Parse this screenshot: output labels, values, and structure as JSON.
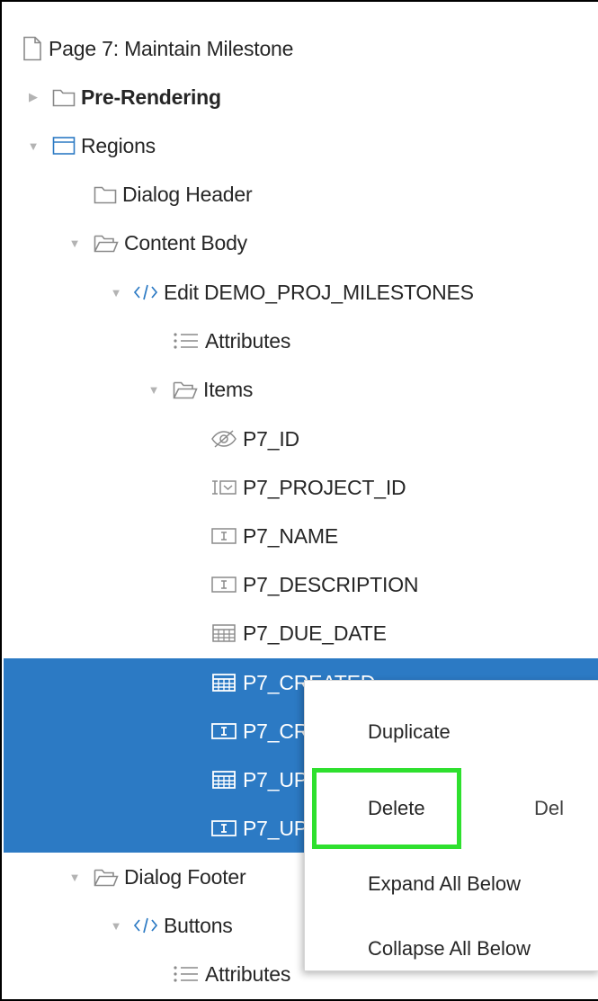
{
  "tree": {
    "rows": [
      {
        "label": "Page 7: Maintain Milestone",
        "icon": "page-icon",
        "toggle": "none"
      },
      {
        "label": "Pre-Rendering",
        "icon": "folder-icon",
        "toggle": "collapsed",
        "bold": true
      },
      {
        "label": "Regions",
        "icon": "region-icon",
        "toggle": "expanded"
      },
      {
        "label": "Dialog Header",
        "icon": "folder-icon",
        "toggle": "none"
      },
      {
        "label": "Content Body",
        "icon": "folder-open-icon",
        "toggle": "expanded"
      },
      {
        "label": "Edit DEMO_PROJ_MILESTONES",
        "icon": "code-icon",
        "toggle": "expanded"
      },
      {
        "label": "Attributes",
        "icon": "list-icon",
        "toggle": "none"
      },
      {
        "label": "Items",
        "icon": "folder-open-icon",
        "toggle": "expanded"
      },
      {
        "label": "P7_ID",
        "icon": "hidden-item-icon",
        "toggle": "none"
      },
      {
        "label": "P7_PROJECT_ID",
        "icon": "select-list-icon",
        "toggle": "none"
      },
      {
        "label": "P7_NAME",
        "icon": "text-field-icon",
        "toggle": "none"
      },
      {
        "label": "P7_DESCRIPTION",
        "icon": "text-field-icon",
        "toggle": "none"
      },
      {
        "label": "P7_DUE_DATE",
        "icon": "date-picker-icon",
        "toggle": "none"
      },
      {
        "label": "P7_CREATED",
        "icon": "date-picker-icon",
        "toggle": "none",
        "selected": true
      },
      {
        "label": "P7_CREATED_BY",
        "icon": "text-field-icon",
        "toggle": "none",
        "selected": true
      },
      {
        "label": "P7_UPDATED",
        "icon": "date-picker-icon",
        "toggle": "none",
        "selected": true
      },
      {
        "label": "P7_UPDATED_BY",
        "icon": "text-field-icon",
        "toggle": "none",
        "selected": true
      },
      {
        "label": "Dialog Footer",
        "icon": "folder-open-icon",
        "toggle": "expanded"
      },
      {
        "label": "Buttons",
        "icon": "code-icon",
        "toggle": "expanded"
      },
      {
        "label": "Attributes",
        "icon": "list-icon",
        "toggle": "none"
      }
    ]
  },
  "context_menu": {
    "items": [
      {
        "label": "Duplicate",
        "shortcut": ""
      },
      {
        "label": "Delete",
        "shortcut": "Del",
        "highlighted": true
      },
      {
        "label": "Expand All Below",
        "shortcut": ""
      },
      {
        "label": "Collapse All Below",
        "shortcut": ""
      }
    ]
  },
  "colors": {
    "selection": "#2c7ac4",
    "icon_blue": "#2c7ac4",
    "icon_gray": "#8a8a8a",
    "focus_outline": "#2ee02e"
  }
}
